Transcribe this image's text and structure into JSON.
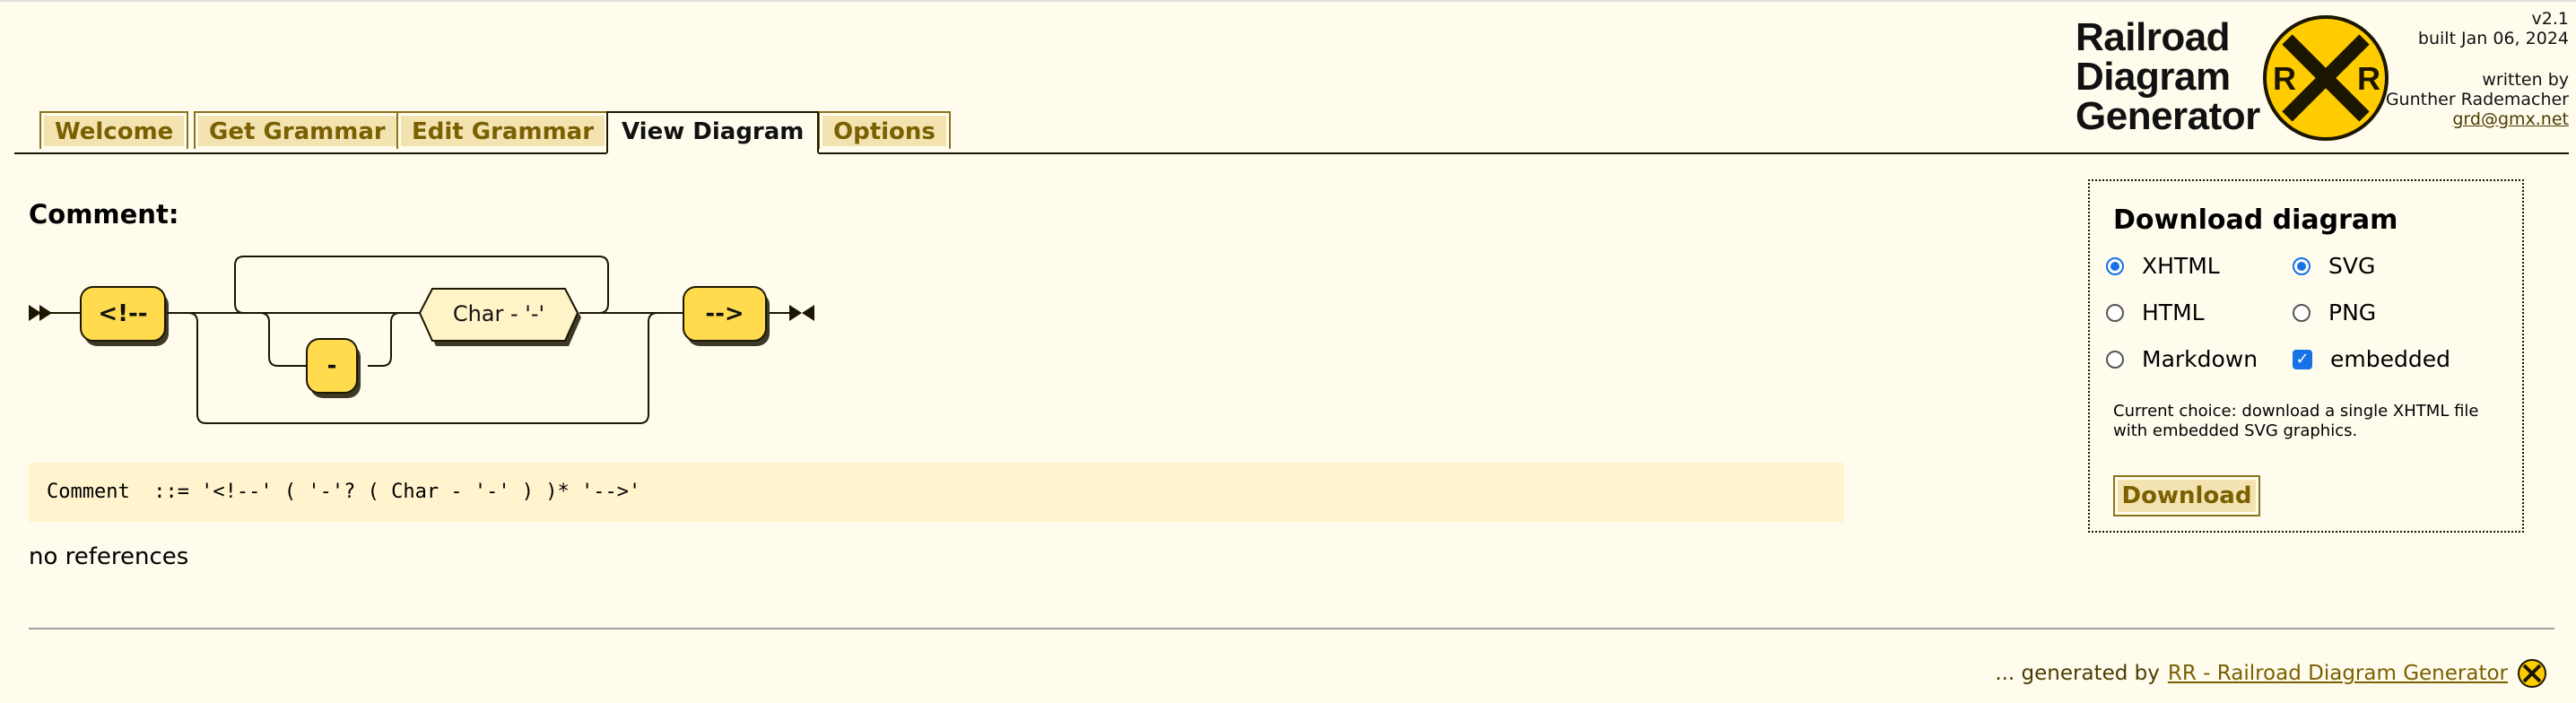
{
  "logo": {
    "line1": "Railroad",
    "line2": "Diagram",
    "line3": "Generator",
    "badge_letter": "R"
  },
  "build": {
    "version": "v2.1",
    "built": "built Jan 06, 2024",
    "written_by": "written by",
    "author": "Gunther Rademacher",
    "email": "grd@gmx.net"
  },
  "tabs": [
    {
      "label": "Welcome"
    },
    {
      "label": "Get Grammar"
    },
    {
      "label": "Edit Grammar"
    },
    {
      "label": "View Diagram",
      "active": true
    },
    {
      "label": "Options"
    }
  ],
  "production": {
    "name": "Comment:",
    "diagram": {
      "start_terminal": "<!--",
      "dash_terminal": "-",
      "nonterminal": "Char - '-'",
      "end_terminal": "-->"
    },
    "ebnf": "Comment  ::= '<!--' ( '-'? ( Char - '-' ) )* '-->'",
    "references": "no references"
  },
  "download": {
    "title": "Download diagram",
    "formats": [
      {
        "label": "XHTML",
        "selected": true
      },
      {
        "label": "HTML",
        "selected": false
      },
      {
        "label": "Markdown",
        "selected": false
      }
    ],
    "graphics": [
      {
        "label": "SVG",
        "selected": true
      },
      {
        "label": "PNG",
        "selected": false
      }
    ],
    "embedded": {
      "label": "embedded",
      "checked": true
    },
    "current_choice": "Current choice: download a single XHTML file with embedded SVG graphics.",
    "button": "Download"
  },
  "footer": {
    "prefix": "... generated by",
    "link": "RR - Railroad Diagram Generator"
  },
  "colors": {
    "background": "#fffcee",
    "terminal": "#ffdb4d",
    "nonterminal": "#fff4c7",
    "tab": "#f2e3b1",
    "accent": "#7a6000",
    "radio": "#1672e6"
  }
}
